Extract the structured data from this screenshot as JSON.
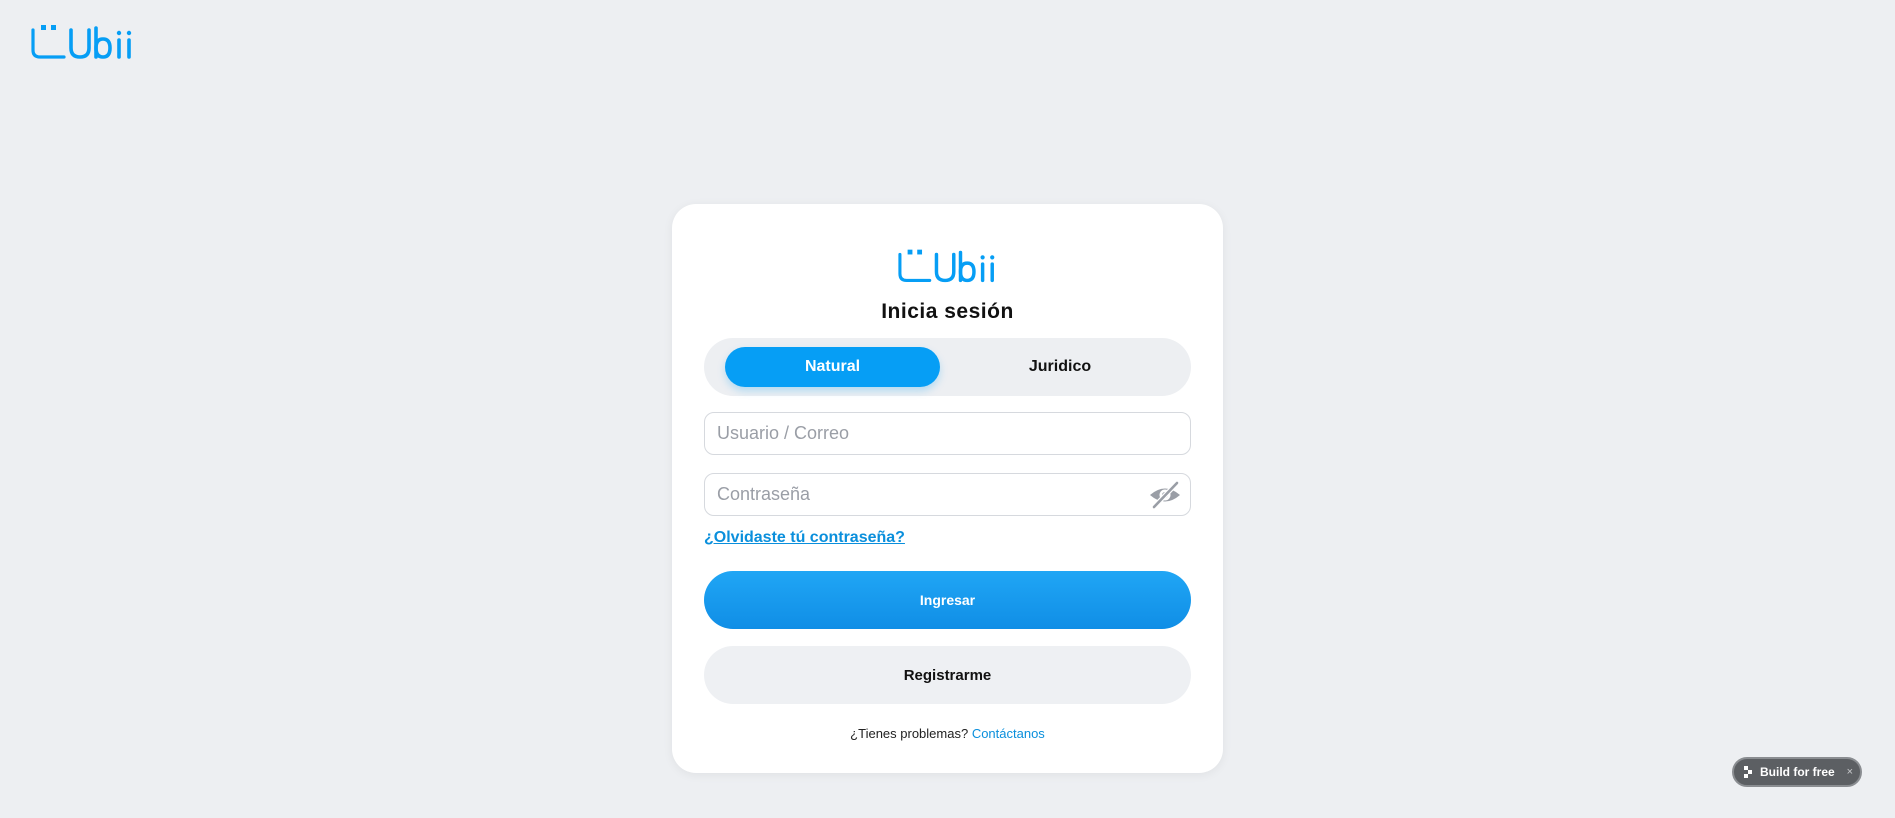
{
  "brand": {
    "name": "Ubii",
    "color": "#069ef5"
  },
  "login": {
    "title": "Inicia sesión",
    "toggle": {
      "options": [
        {
          "label": "Natural",
          "active": true
        },
        {
          "label": "Juridico",
          "active": false
        }
      ]
    },
    "username": {
      "value": "",
      "placeholder": "Usuario / Correo"
    },
    "password": {
      "value": "",
      "placeholder": "Contraseña",
      "toggle_icon": "eye-slash-icon"
    },
    "forgot_label": "¿Olvidaste tú contraseña?",
    "submit_label": "Ingresar",
    "register_label": "Registrarme",
    "help": {
      "text": "¿Tienes problemas?",
      "link_label": "Contáctanos"
    }
  },
  "build_badge": {
    "label": "Build for free",
    "close": "×",
    "bg_color": "#5c5f63"
  }
}
